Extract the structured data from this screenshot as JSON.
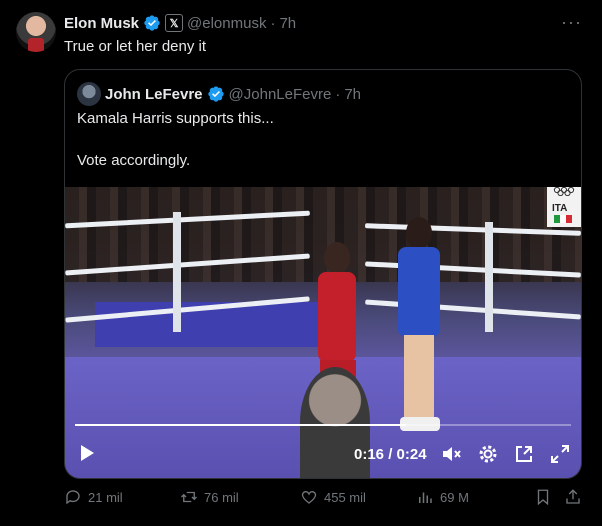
{
  "tweet": {
    "author_name": "Elon Musk",
    "badge_x": "𝕏",
    "handle": "@elonmusk",
    "separator": "·",
    "time": "7h",
    "more": "···",
    "text": "True or let her deny it"
  },
  "quote": {
    "author_name": "John LeFevre",
    "handle": "@JohnLeFevre",
    "separator": "·",
    "time": "7h",
    "line1": "Kamala Harris supports this...",
    "line2": "Vote accordingly.",
    "video": {
      "time_display": "0:16 / 0:24",
      "progress": 0.667,
      "overlay_country": "ITA"
    }
  },
  "actions": {
    "replies": "21 mil",
    "retweets": "76 mil",
    "likes": "455 mil",
    "views": "69 M"
  },
  "colors": {
    "background": "#000000",
    "text": "#e7e9ea",
    "muted": "#71767b",
    "verified": "#1d9bf0",
    "border": "#2f3336"
  }
}
